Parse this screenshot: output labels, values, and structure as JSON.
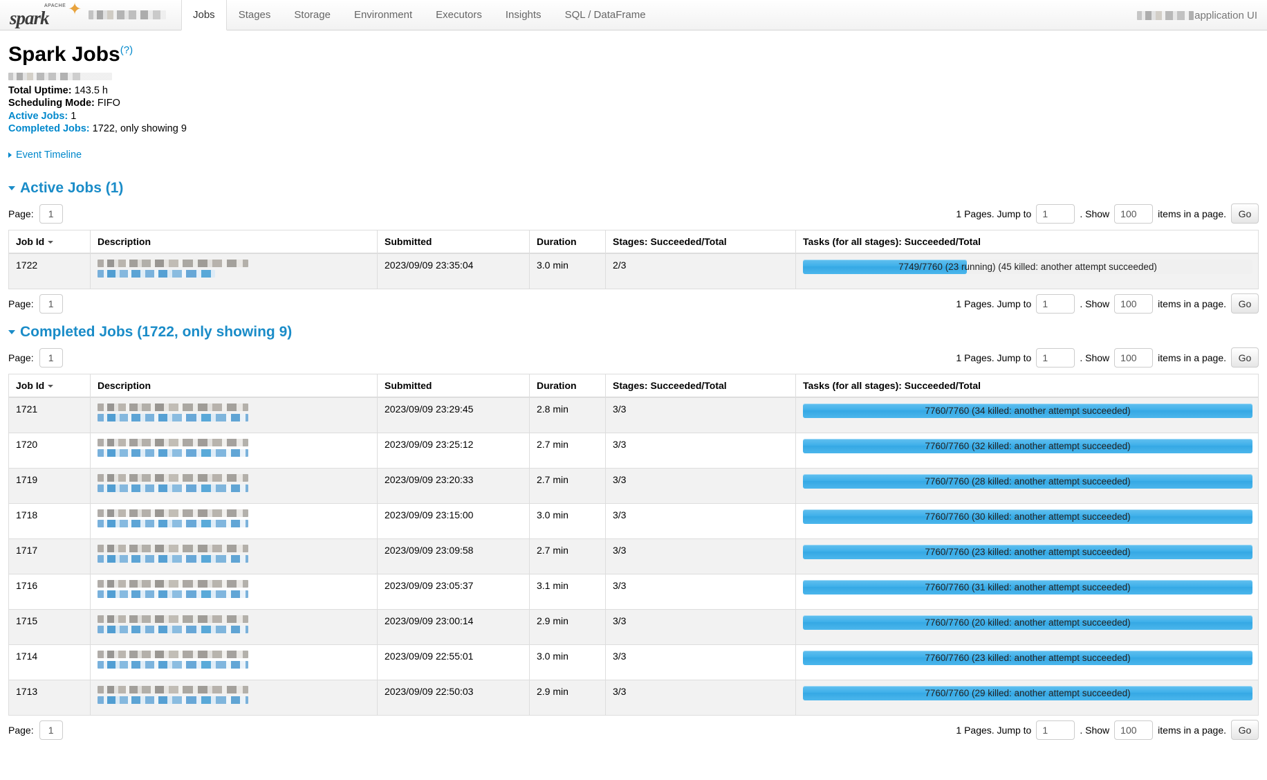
{
  "navbar": {
    "brand_logo_text": "spark",
    "brand_logo_super": "APACHE",
    "tabs": [
      {
        "label": "Jobs",
        "active": true
      },
      {
        "label": "Stages",
        "active": false
      },
      {
        "label": "Storage",
        "active": false
      },
      {
        "label": "Environment",
        "active": false
      },
      {
        "label": "Executors",
        "active": false
      },
      {
        "label": "Insights",
        "active": false
      },
      {
        "label": "SQL / DataFrame",
        "active": false
      }
    ],
    "right_label": "application UI"
  },
  "header": {
    "title": "Spark Jobs",
    "help_glyph": "(?)",
    "total_uptime_label": "Total Uptime:",
    "total_uptime_value": "143.5 h",
    "scheduling_mode_label": "Scheduling Mode:",
    "scheduling_mode_value": "FIFO",
    "active_jobs_label": "Active Jobs:",
    "active_jobs_value": "1",
    "completed_jobs_label": "Completed Jobs:",
    "completed_jobs_value": "1722, only showing 9",
    "event_timeline_label": "Event Timeline"
  },
  "active_section": {
    "title": "Active Jobs (1)",
    "pagination": {
      "page_label": "Page:",
      "page_value": "1",
      "pages_text": "1 Pages. Jump to",
      "jump_value": "1",
      "show_text": ". Show",
      "show_value": "100",
      "items_text": "items in a page.",
      "go_label": "Go"
    },
    "columns": [
      "Job Id",
      "Description",
      "Submitted",
      "Duration",
      "Stages: Succeeded/Total",
      "Tasks (for all stages): Succeeded/Total"
    ],
    "rows": [
      {
        "job_id": "1722",
        "description": "",
        "submitted": "2023/09/09 23:35:04",
        "duration": "3.0 min",
        "stages": "2/3",
        "tasks_text": "7749/7760 (23 running) (45 killed: another attempt succeeded)",
        "tasks_percent": 36.5
      }
    ]
  },
  "completed_section": {
    "title": "Completed Jobs (1722, only showing 9)",
    "pagination": {
      "page_label": "Page:",
      "page_value": "1",
      "pages_text": "1 Pages. Jump to",
      "jump_value": "1",
      "show_text": ". Show",
      "show_value": "100",
      "items_text": "items in a page.",
      "go_label": "Go"
    },
    "columns": [
      "Job Id",
      "Description",
      "Submitted",
      "Duration",
      "Stages: Succeeded/Total",
      "Tasks (for all stages): Succeeded/Total"
    ],
    "rows": [
      {
        "job_id": "1721",
        "submitted": "2023/09/09 23:29:45",
        "duration": "2.8 min",
        "stages": "3/3",
        "tasks_text": "7760/7760 (34 killed: another attempt succeeded)",
        "tasks_percent": 100
      },
      {
        "job_id": "1720",
        "submitted": "2023/09/09 23:25:12",
        "duration": "2.7 min",
        "stages": "3/3",
        "tasks_text": "7760/7760 (32 killed: another attempt succeeded)",
        "tasks_percent": 100
      },
      {
        "job_id": "1719",
        "submitted": "2023/09/09 23:20:33",
        "duration": "2.7 min",
        "stages": "3/3",
        "tasks_text": "7760/7760 (28 killed: another attempt succeeded)",
        "tasks_percent": 100
      },
      {
        "job_id": "1718",
        "submitted": "2023/09/09 23:15:00",
        "duration": "3.0 min",
        "stages": "3/3",
        "tasks_text": "7760/7760 (30 killed: another attempt succeeded)",
        "tasks_percent": 100
      },
      {
        "job_id": "1717",
        "submitted": "2023/09/09 23:09:58",
        "duration": "2.7 min",
        "stages": "3/3",
        "tasks_text": "7760/7760 (23 killed: another attempt succeeded)",
        "tasks_percent": 100
      },
      {
        "job_id": "1716",
        "submitted": "2023/09/09 23:05:37",
        "duration": "3.1 min",
        "stages": "3/3",
        "tasks_text": "7760/7760 (31 killed: another attempt succeeded)",
        "tasks_percent": 100
      },
      {
        "job_id": "1715",
        "submitted": "2023/09/09 23:00:14",
        "duration": "2.9 min",
        "stages": "3/3",
        "tasks_text": "7760/7760 (20 killed: another attempt succeeded)",
        "tasks_percent": 100
      },
      {
        "job_id": "1714",
        "submitted": "2023/09/09 22:55:01",
        "duration": "3.0 min",
        "stages": "3/3",
        "tasks_text": "7760/7760 (23 killed: another attempt succeeded)",
        "tasks_percent": 100
      },
      {
        "job_id": "1713",
        "submitted": "2023/09/09 22:50:03",
        "duration": "2.9 min",
        "stages": "3/3",
        "tasks_text": "7760/7760 (29 killed: another attempt succeeded)",
        "tasks_percent": 100
      }
    ]
  },
  "colors": {
    "accent_blue": "#0088cc",
    "section_blue": "#1a8cc8",
    "progress_blue": "#3fb0ea",
    "row_alt": "#f2f2f2"
  }
}
